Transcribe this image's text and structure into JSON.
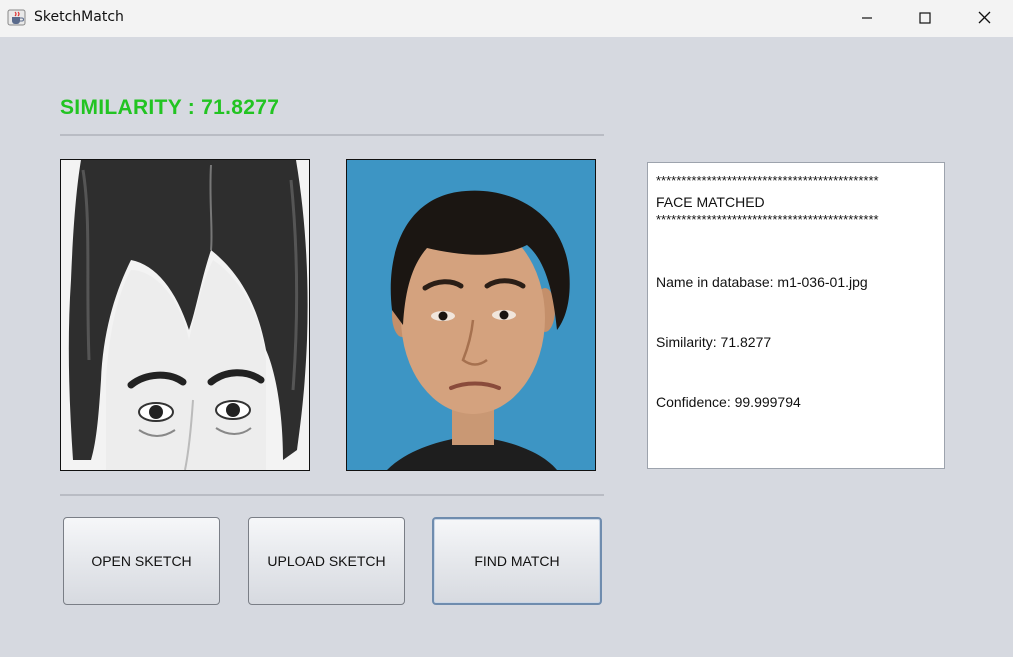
{
  "window": {
    "title": "SketchMatch",
    "icon": "java-cup-icon",
    "controls": [
      "minimize-icon",
      "maximize-icon",
      "close-icon"
    ]
  },
  "header": {
    "similarity_text": "SIMILARITY : 71.8277",
    "color": "#22c422"
  },
  "images": {
    "sketch": "pencil-sketch-face-image",
    "photo": "matched-face-photo-image"
  },
  "result": {
    "stars_top": "********************************************",
    "status": "FACE MATCHED",
    "stars_bottom": "********************************************",
    "name_line": "Name in database: m1-036-01.jpg",
    "similarity_line": "Similarity: 71.8277",
    "confidence_line": "Confidence: 99.999794"
  },
  "buttons": {
    "open_sketch": "OPEN SKETCH",
    "upload_sketch": "UPLOAD SKETCH",
    "find_match": "FIND MATCH"
  }
}
